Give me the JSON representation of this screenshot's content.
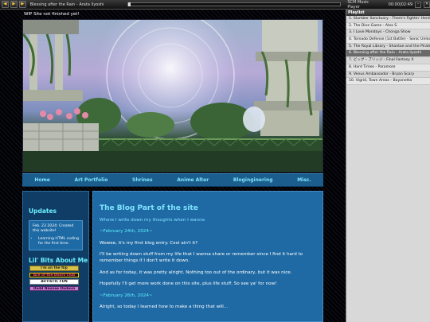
{
  "player": {
    "now_playing": "Blessing after the Rain - Arata Iiyoshi",
    "name": "SCM Music Player",
    "time": "00:00|02:49",
    "progress": 0.0,
    "icons": [
      "prev-icon",
      "play-icon",
      "next-icon"
    ]
  },
  "playlist": {
    "title": "Playlist",
    "items": [
      "1. Slumber Sanctuary - Them's Fightin' Herds",
      "2. The Dive Game - Alex S.",
      "3. I Love Mondays - Chonga Show",
      "4. Tornado Defense (1st Battle) - Sonic Unleashed",
      "5. The Royal Library - Shantae and the Pirate's Curse",
      "6. Blessing after the Rain - Arata Iiyoshi",
      "7. ビッグ・ブリッジ - Final Fantasy X",
      "8. Hard Times - Paramore",
      "9. Venus Ambassador - Bryan Scary",
      "10. Vigrid, Town Areas - Bayonetta"
    ],
    "active_index": 5
  },
  "site": {
    "wip": "WIP Site not finished yet!",
    "nav": [
      "Home",
      "Art Portfolio",
      "Shrines",
      "Anime Alter",
      "Bloginginering",
      "Misc."
    ],
    "sidebar": {
      "updates_title": "Updates",
      "update_date": "Feb. 23 2024: Created this website!",
      "update_items": [
        "Learning HTML coding for the first time."
      ],
      "bits_title": "Lil' Bits About Me",
      "stamps": [
        "I'm on the flip",
        "Ace of the Doors Club",
        "AUTISTIC FUN",
        "Dadd Nauvee Dudeun"
      ]
    },
    "main": {
      "title": "The Blog Part of the site",
      "subtitle": "Where I write down my thoughts when I wanna",
      "date1": "~February 24th, 2024~",
      "p1": "Wowee, it's my first blog entry. Cool ain't it?",
      "p2": "I'll be writing down stuff from my life that I wanna share or remember since I find it hard to remember things if I don't write it down.",
      "p3": "And as for today, it was pretty alright. Nothing too out of the ordinary, but it was nice.",
      "p4": "Hopefully I'll get more work done on this site, plus life stuff. So see ya' for now!",
      "date2": "~February 26th, 2024~",
      "p5": "Alright, so today I learned how to make a thing that will..."
    }
  },
  "colors": {
    "nav_bg": "#1b5d8c",
    "panel_bg": "#1f6aa4",
    "accent": "#7fe3ff",
    "playlist_active": "#6a6a6a"
  }
}
